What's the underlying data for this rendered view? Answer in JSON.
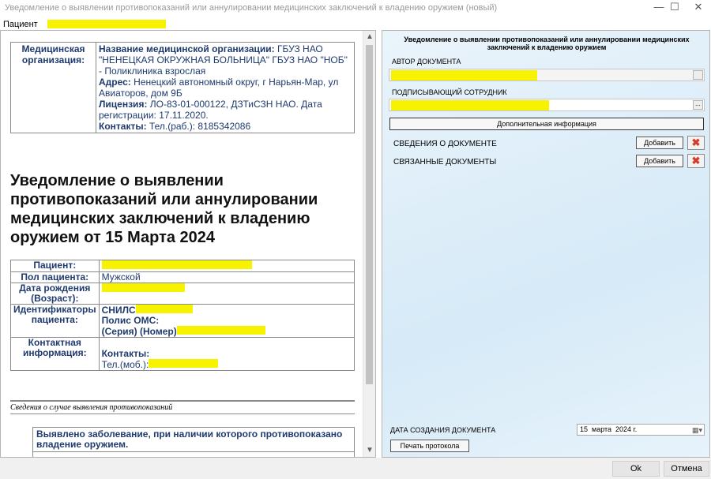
{
  "window": {
    "title": "Уведомление о выявлении противопоказаний или аннулировании медицинских заключений к владению оружием (новый)",
    "minimize_glyph": "—",
    "maximize_glyph": "☐",
    "close_glyph": "✕"
  },
  "patient_bar": {
    "label": "Пациент"
  },
  "document": {
    "org_label": "Медицинская организация:",
    "org_name_label": "Название медицинской организации:",
    "org_name_value": " ГБУЗ НАО \"НЕНЕЦКАЯ ОКРУЖНАЯ БОЛЬНИЦА\" ГБУЗ НАО \"НОБ\" - Поликлиника взрослая",
    "address_label": "Адрес:",
    "address_value": " Ненецкий автономный округ, г Нарьян-Мар, ул Авиаторов, дом 9Б",
    "license_label": "Лицензия:",
    "license_value": " ЛО-83-01-000122, ДЗТиСЗН НАО. Дата регистрации: 17.11.2020.",
    "contacts_label": "Контакты:",
    "contacts_value": " Тел.(раб.): 8185342086",
    "title": "Уведомление о выявлении противопоказаний или аннулировании медицинских заключений к владению оружием от 15 Марта 2024",
    "patient_table": {
      "patient_label": "Пациент:",
      "sex_label": "Пол пациента:",
      "sex_value": "Мужской",
      "dob_label": "Дата рождения (Возраст):",
      "ids_label": "Идентификаторы пациента:",
      "snils_label": "СНИЛС",
      "oms_label": "Полис ОМС:",
      "series_number_label": "(Серия) (Номер)",
      "contact_info_label": "Контактная информация:",
      "contacts_label": "Контакты:",
      "phone_label": "Тел.(моб.):"
    },
    "section_title": "Сведения о случае выявления противопоказаний",
    "diagnosis_text": "Выявлено заболевание, при наличии которого противопоказано владение оружием."
  },
  "right_panel": {
    "title": "Уведомление о выявлении противопоказаний или аннулировании медицинских заключений к владению оружием",
    "author_label": "АВТОР ДОКУМЕНТА",
    "signer_label": "ПОДПИСЫВАЮЩИЙ СОТРУДНИК",
    "browse_glyph": "...",
    "additional_info_button": "Дополнительная информация",
    "doc_info_label": "СВЕДЕНИЯ О ДОКУМЕНТЕ",
    "related_docs_label": "СВЯЗАННЫЕ ДОКУМЕНТЫ",
    "add_button": "Добавить",
    "creation_date_label": "ДАТА СОЗДАНИЯ ДОКУМЕНТА",
    "creation_date_value": "15  марта  2024 г.",
    "print_button": "Печать протокола"
  },
  "footer": {
    "ok_button": "Ok",
    "cancel_button": "Отмена"
  },
  "colors": {
    "redaction": "#f7f300",
    "label_blue": "#1f3a6e",
    "delete_red": "#d43b2a"
  }
}
